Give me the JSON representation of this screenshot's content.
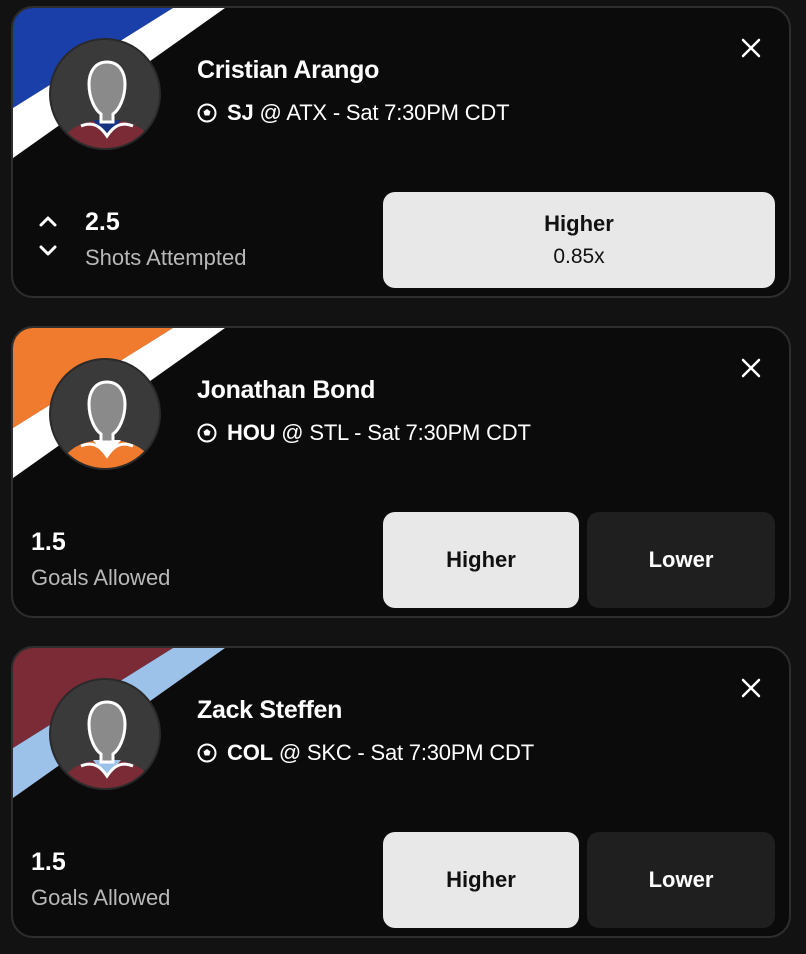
{
  "cards": [
    {
      "player": "Cristian Arango",
      "home": "SJ",
      "matchup": "@ ATX - Sat 7:30PM CDT",
      "line": "2.5",
      "stat": "Shots Attempted",
      "higher_label": "Higher",
      "multiplier": "0.85x",
      "colors": {
        "primary": "#1a3fa8",
        "secondary": "#ffffff",
        "jersey": "#7a2b36",
        "collar": "#16337f"
      }
    },
    {
      "player": "Jonathan Bond",
      "home": "HOU",
      "matchup": "@ STL - Sat 7:30PM CDT",
      "line": "1.5",
      "stat": "Goals Allowed",
      "higher_label": "Higher",
      "lower_label": "Lower",
      "colors": {
        "primary": "#f07a2e",
        "secondary": "#ffffff",
        "jersey": "#f07a2e",
        "collar": "#ffffff"
      }
    },
    {
      "player": "Zack Steffen",
      "home": "COL",
      "matchup": "@ SKC - Sat 7:30PM CDT",
      "line": "1.5",
      "stat": "Goals Allowed",
      "higher_label": "Higher",
      "lower_label": "Lower",
      "colors": {
        "primary": "#7a2b36",
        "secondary": "#9cc2ea",
        "jersey": "#7a2b36",
        "collar": "#9cc2ea"
      }
    }
  ],
  "icons": {
    "close": "close-icon",
    "sport": "soccer-ball-icon",
    "up": "chevron-up-icon",
    "down": "chevron-down-icon"
  }
}
